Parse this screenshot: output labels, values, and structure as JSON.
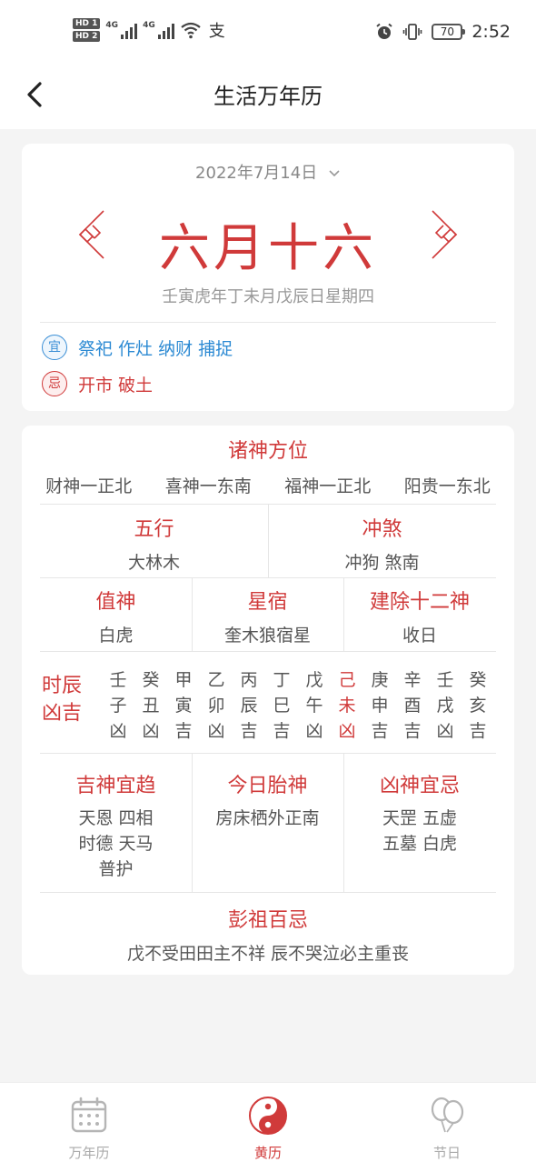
{
  "status_bar": {
    "hd1": "HD 1",
    "hd2": "HD 2",
    "net1": "4G",
    "net2": "4G",
    "extra": "支",
    "battery": "70",
    "time": "2:52"
  },
  "header": {
    "title": "生活万年历"
  },
  "date_card": {
    "date_picker": "2022年7月14日",
    "lunar_date": "六月十六",
    "ganzhi": "壬寅虎年丁未月戊辰日星期四",
    "yi_label": "宜",
    "yi_items": "祭祀 作灶 纳财 捕捉",
    "ji_label": "忌",
    "ji_items": "开市 破土"
  },
  "almanac": {
    "zhushen_title": "诸神方位",
    "zhushen": [
      "财神一正北",
      "喜神一东南",
      "福神一正北",
      "阳贵一东北"
    ],
    "wuxing_title": "五行",
    "wuxing_value": "大林木",
    "chongsha_title": "冲煞",
    "chongsha_value": "冲狗 煞南",
    "zhishen_title": "值神",
    "zhishen_value": "白虎",
    "xingxiu_title": "星宿",
    "xingxiu_value": "奎木狼宿星",
    "jianchu_title": "建除十二神",
    "jianchu_value": "收日",
    "hour_label_1": "时辰",
    "hour_label_2": "凶吉",
    "hours": [
      {
        "gan": "壬",
        "zhi": "子",
        "luck": "凶"
      },
      {
        "gan": "癸",
        "zhi": "丑",
        "luck": "凶"
      },
      {
        "gan": "甲",
        "zhi": "寅",
        "luck": "吉"
      },
      {
        "gan": "乙",
        "zhi": "卯",
        "luck": "凶"
      },
      {
        "gan": "丙",
        "zhi": "辰",
        "luck": "吉"
      },
      {
        "gan": "丁",
        "zhi": "巳",
        "luck": "吉"
      },
      {
        "gan": "戊",
        "zhi": "午",
        "luck": "凶"
      },
      {
        "gan": "己",
        "zhi": "未",
        "luck": "凶",
        "current": true
      },
      {
        "gan": "庚",
        "zhi": "申",
        "luck": "吉"
      },
      {
        "gan": "辛",
        "zhi": "酉",
        "luck": "吉"
      },
      {
        "gan": "壬",
        "zhi": "戌",
        "luck": "凶"
      },
      {
        "gan": "癸",
        "zhi": "亥",
        "luck": "吉"
      }
    ],
    "jishen_title": "吉神宜趋",
    "jishen_lines": [
      "天恩 四相",
      "时德 天马",
      "普护"
    ],
    "taishen_title": "今日胎神",
    "taishen_value": "房床栖外正南",
    "xiongshen_title": "凶神宜忌",
    "xiongshen_lines": [
      "天罡 五虚",
      "五墓 白虎"
    ],
    "pengzu_title": "彭祖百忌",
    "pengzu_value": "戊不受田田主不祥 辰不哭泣必主重丧"
  },
  "bottom_nav": {
    "items": [
      {
        "label": "万年历",
        "icon": "calendar-icon",
        "active": false
      },
      {
        "label": "黄历",
        "icon": "yin-yang-icon",
        "active": true
      },
      {
        "label": "节日",
        "icon": "balloon-icon",
        "active": false
      }
    ]
  },
  "colors": {
    "accent_red": "#d03a3a",
    "yi_blue": "#2c8ad3"
  }
}
